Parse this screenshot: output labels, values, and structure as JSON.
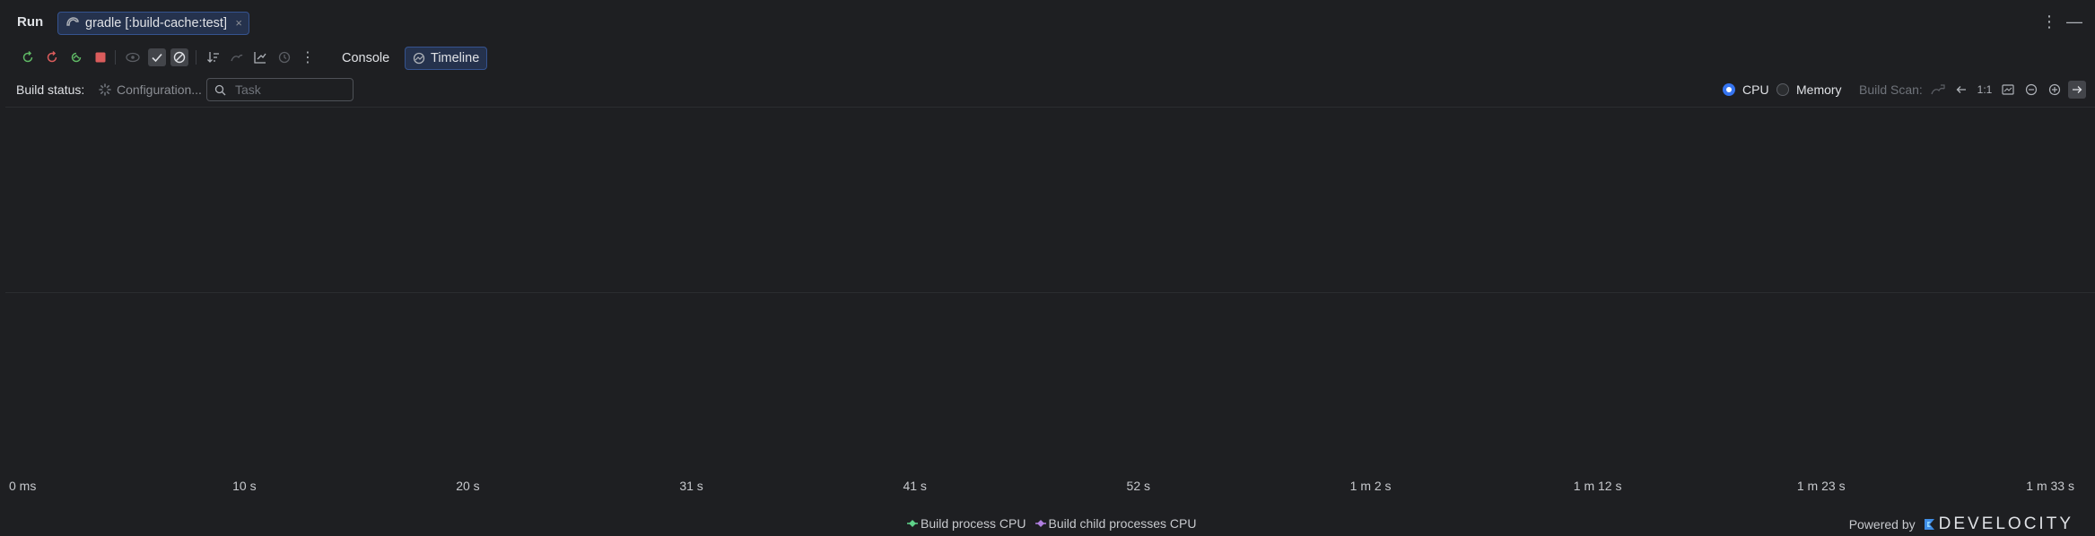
{
  "header": {
    "title": "Run",
    "tab_label": "gradle [:build-cache:test]",
    "tab_close": "×"
  },
  "toolbar": {
    "console_label": "Console",
    "timeline_label": "Timeline"
  },
  "status": {
    "label": "Build status:",
    "value": "Configuration...",
    "search_placeholder": "Task",
    "search_value": ""
  },
  "controls": {
    "cpu_label": "CPU",
    "memory_label": "Memory",
    "selected": "CPU",
    "build_scan_label": "Build Scan:",
    "zoom_reset_label": "1:1"
  },
  "chart_data": {
    "type": "area",
    "x_tick_labels": [
      "0 ms",
      "10 s",
      "20 s",
      "31 s",
      "41 s",
      "52 s",
      "1 m 2 s",
      "1 m 12 s",
      "1 m 23 s",
      "1 m 33 s"
    ],
    "series": [
      {
        "name": "Build process CPU",
        "color": "#5fd38a",
        "values": []
      },
      {
        "name": "Build child processes CPU",
        "color": "#b07fe0",
        "values": []
      }
    ]
  },
  "footer": {
    "powered_by": "Powered by",
    "brand": "DEVELOCITY"
  },
  "colors": {
    "accent": "#3574f0",
    "stop": "#db5c5c",
    "rerun": "#5fb865"
  }
}
